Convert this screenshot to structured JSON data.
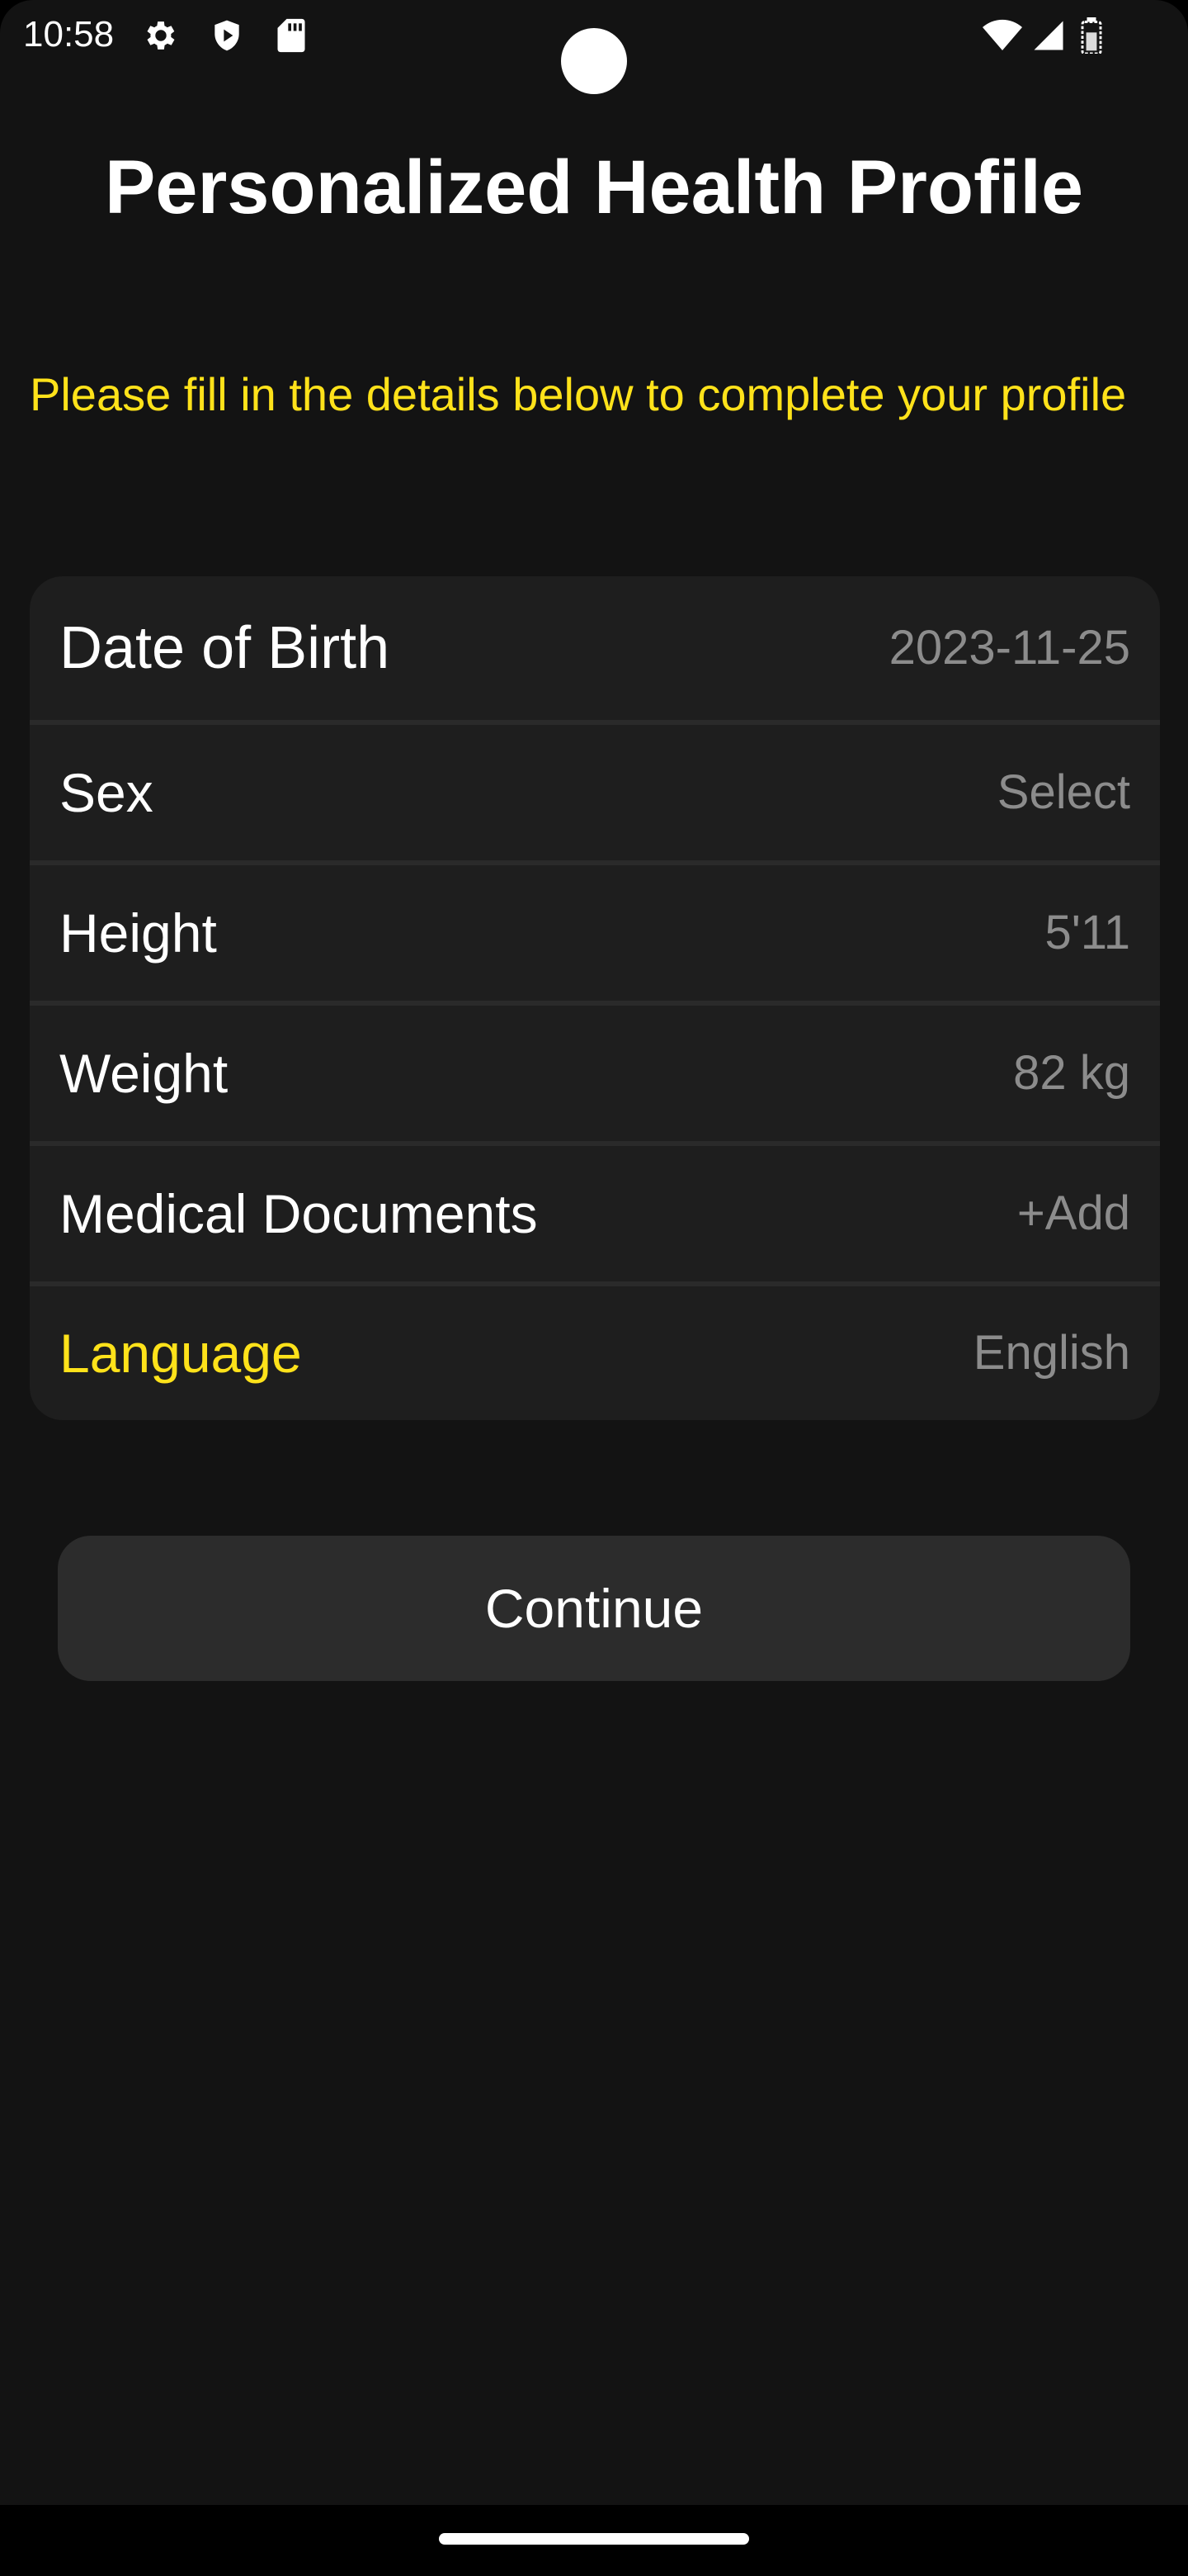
{
  "status_bar": {
    "time": "10:58",
    "icons_left": [
      "gear-icon",
      "shield-play-icon",
      "sd-card-icon"
    ],
    "icons_right": [
      "wifi-icon",
      "cell-signal-icon",
      "battery-icon"
    ]
  },
  "header": {
    "title": "Personalized Health Profile",
    "subtitle": "Please fill in the details below to complete your profile"
  },
  "form": {
    "rows": [
      {
        "label": "Date of Birth",
        "value": "2023-11-25"
      },
      {
        "label": "Sex",
        "value": "Select"
      },
      {
        "label": "Height",
        "value": "5'11"
      },
      {
        "label": "Weight",
        "value": "82 kg"
      },
      {
        "label": "Medical Documents",
        "value": "+Add"
      },
      {
        "label": "Language",
        "value": "English"
      }
    ]
  },
  "actions": {
    "continue_label": "Continue"
  },
  "colors": {
    "background": "#131313",
    "card": "#1e1e1e",
    "accent": "#ffe21a",
    "value_text": "#8c8c8c",
    "button": "#2c2c2c"
  }
}
